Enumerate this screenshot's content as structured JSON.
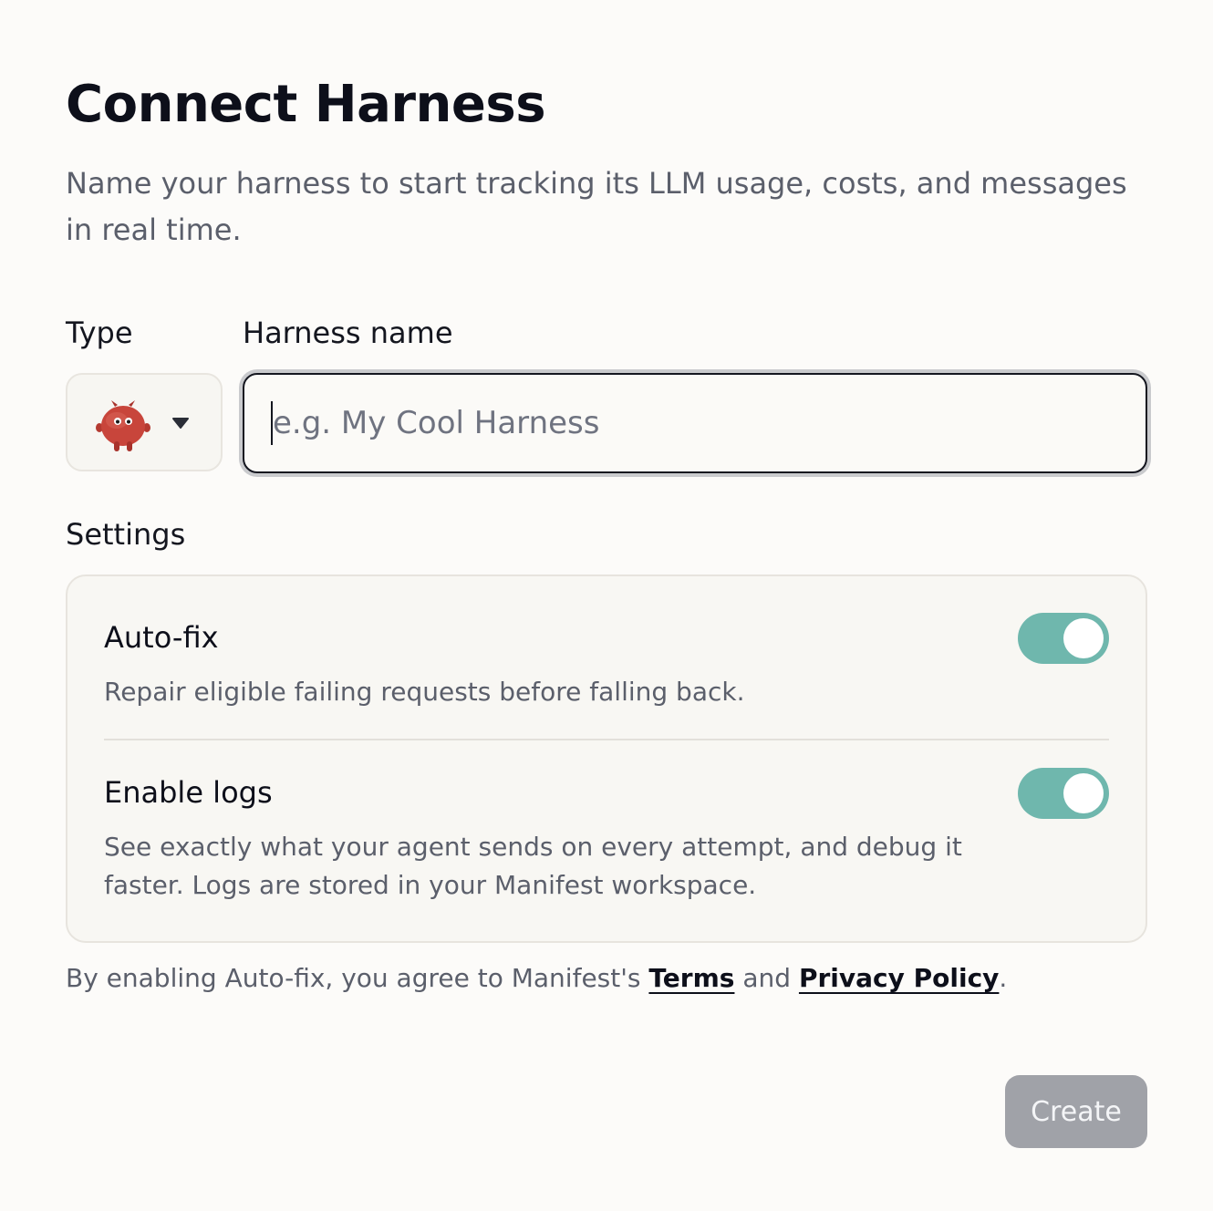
{
  "header": {
    "title": "Connect Harness",
    "subtitle": "Name your harness to start tracking its LLM usage, costs, and messages in real time."
  },
  "form": {
    "type_label": "Type",
    "type_icon": "red-creature-avatar-icon",
    "name_label": "Harness name",
    "name_value": "",
    "name_placeholder": "e.g. My Cool Harness"
  },
  "settings": {
    "label": "Settings",
    "items": [
      {
        "title": "Auto-fix",
        "description": "Repair eligible failing requests before falling back.",
        "enabled": true
      },
      {
        "title": "Enable logs",
        "description": "See exactly what your agent sends on every attempt, and debug it faster. Logs are stored in your Manifest workspace.",
        "enabled": true
      }
    ]
  },
  "legal": {
    "prefix": "By enabling Auto-fix, you agree to Manifest's ",
    "terms_label": "Terms",
    "middle": " and ",
    "privacy_label": "Privacy Policy",
    "suffix": "."
  },
  "actions": {
    "create_label": "Create"
  },
  "colors": {
    "toggle_on": "#6fb7ad",
    "button_disabled": "#a0a2a8",
    "avatar": "#c8453b"
  }
}
